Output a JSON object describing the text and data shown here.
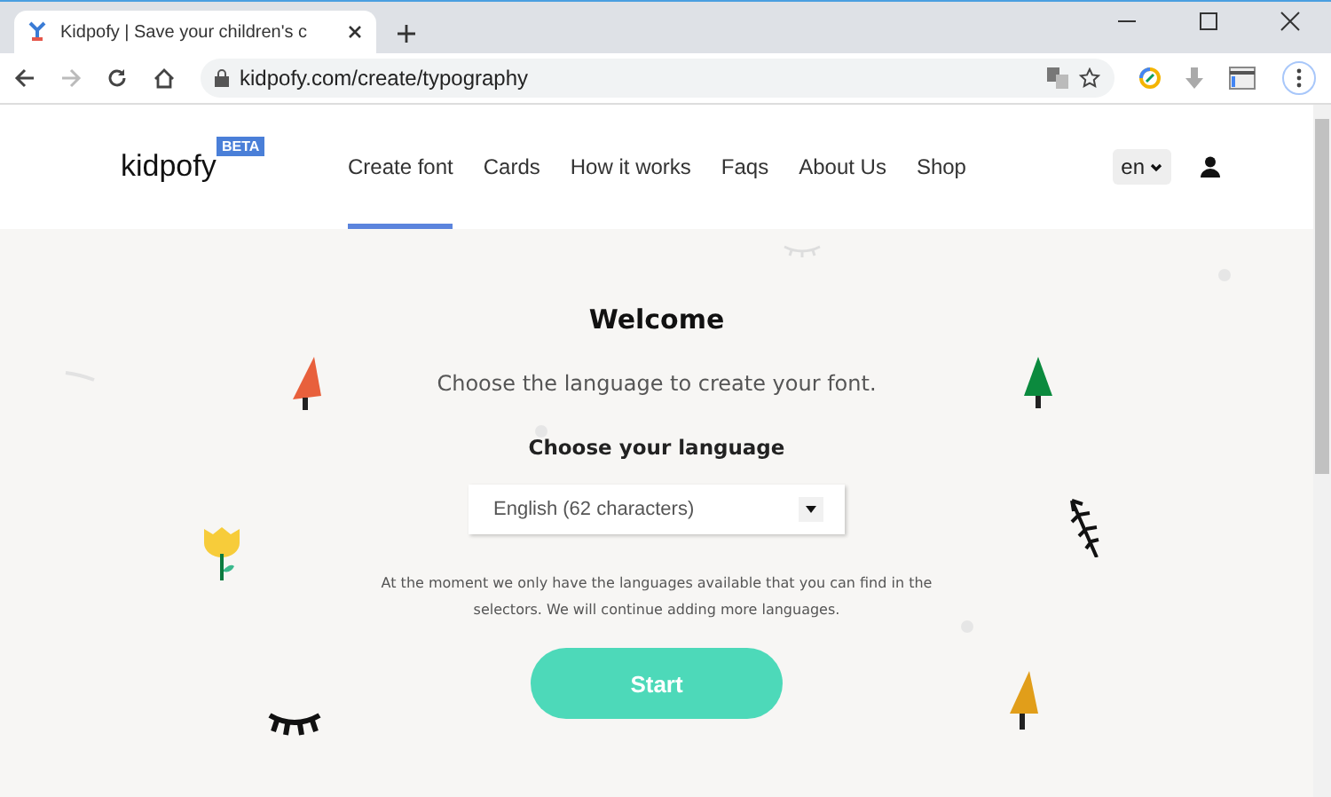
{
  "browser": {
    "tab_title": "Kidpofy | Save your children's c",
    "address": "kidpofy.com/create/typography"
  },
  "header": {
    "logo": "kidpofy",
    "badge": "BETA",
    "language": "en",
    "nav": [
      {
        "label": "Create font",
        "selected": true
      },
      {
        "label": "Cards",
        "selected": false
      },
      {
        "label": "How it works",
        "selected": false
      },
      {
        "label": "Faqs",
        "selected": false
      },
      {
        "label": "About Us",
        "selected": false
      },
      {
        "label": "Shop",
        "selected": false
      }
    ]
  },
  "main": {
    "title": "Welcome",
    "subtitle": "Choose the language to create your font.",
    "select_label": "Choose your language",
    "select_value": "English (62 characters)",
    "note": "At the moment we only have the languages available that you can find in the selectors. We will continue adding more languages.",
    "button": "Start"
  }
}
